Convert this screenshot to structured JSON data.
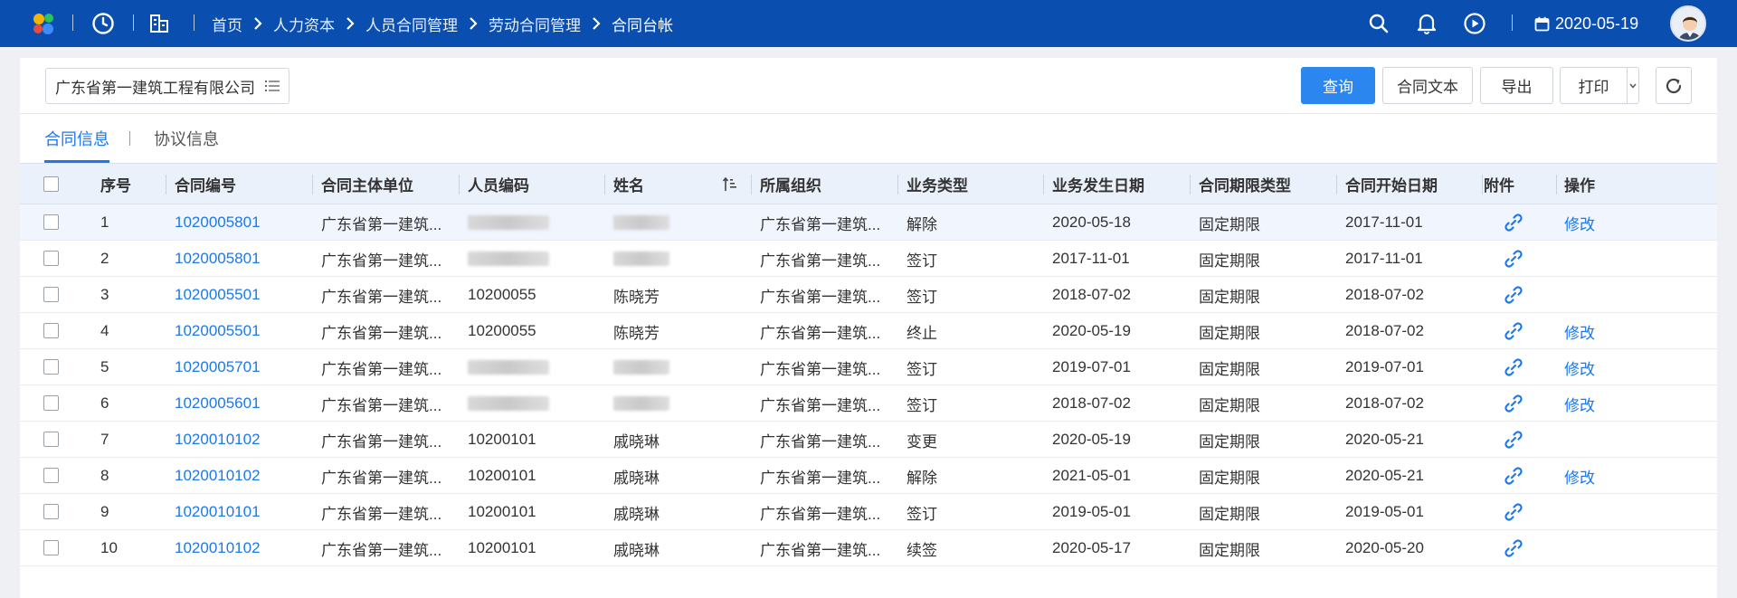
{
  "topbar": {
    "breadcrumbs": [
      "首页",
      "人力资本",
      "人员合同管理",
      "劳动合同管理",
      "合同台帐"
    ],
    "date": "2020-05-19",
    "icons": [
      "app-logo-icon",
      "clock-icon",
      "building-icon",
      "search-icon",
      "bell-icon",
      "play-circle-icon",
      "calendar-icon",
      "avatar"
    ]
  },
  "toolbar": {
    "company": "广东省第一建筑工程有限公司",
    "query_label": "查询",
    "contract_text_label": "合同文本",
    "export_label": "导出",
    "print_label": "打印"
  },
  "tabs": [
    {
      "label": "合同信息",
      "active": true
    },
    {
      "label": "协议信息",
      "active": false
    }
  ],
  "table": {
    "headers": [
      "序号",
      "合同编号",
      "合同主体单位",
      "人员编码",
      "姓名",
      "所属组织",
      "业务类型",
      "业务发生日期",
      "合同期限类型",
      "合同开始日期",
      "附件",
      "操作"
    ],
    "rows": [
      {
        "no": "1",
        "contract_no": "1020005801",
        "entity": "广东省第一建筑...",
        "code": "",
        "name": "",
        "org": "广东省第一建筑...",
        "type": "解除",
        "date": "2020-05-18",
        "term": "固定期限",
        "start": "2017-11-01",
        "action": "修改"
      },
      {
        "no": "2",
        "contract_no": "1020005801",
        "entity": "广东省第一建筑...",
        "code": "",
        "name": "",
        "org": "广东省第一建筑...",
        "type": "签订",
        "date": "2017-11-01",
        "term": "固定期限",
        "start": "2017-11-01",
        "action": ""
      },
      {
        "no": "3",
        "contract_no": "1020005501",
        "entity": "广东省第一建筑...",
        "code": "10200055",
        "name": "陈晓芳",
        "org": "广东省第一建筑...",
        "type": "签订",
        "date": "2018-07-02",
        "term": "固定期限",
        "start": "2018-07-02",
        "action": ""
      },
      {
        "no": "4",
        "contract_no": "1020005501",
        "entity": "广东省第一建筑...",
        "code": "10200055",
        "name": "陈晓芳",
        "org": "广东省第一建筑...",
        "type": "终止",
        "date": "2020-05-19",
        "term": "固定期限",
        "start": "2018-07-02",
        "action": "修改"
      },
      {
        "no": "5",
        "contract_no": "1020005701",
        "entity": "广东省第一建筑...",
        "code": "",
        "name": "",
        "org": "广东省第一建筑...",
        "type": "签订",
        "date": "2019-07-01",
        "term": "固定期限",
        "start": "2019-07-01",
        "action": "修改"
      },
      {
        "no": "6",
        "contract_no": "1020005601",
        "entity": "广东省第一建筑...",
        "code": "",
        "name": "",
        "org": "广东省第一建筑...",
        "type": "签订",
        "date": "2018-07-02",
        "term": "固定期限",
        "start": "2018-07-02",
        "action": "修改"
      },
      {
        "no": "7",
        "contract_no": "1020010102",
        "entity": "广东省第一建筑...",
        "code": "10200101",
        "name": "戚晓琳",
        "org": "广东省第一建筑...",
        "type": "变更",
        "date": "2020-05-19",
        "term": "固定期限",
        "start": "2020-05-21",
        "action": ""
      },
      {
        "no": "8",
        "contract_no": "1020010102",
        "entity": "广东省第一建筑...",
        "code": "10200101",
        "name": "戚晓琳",
        "org": "广东省第一建筑...",
        "type": "解除",
        "date": "2021-05-01",
        "term": "固定期限",
        "start": "2020-05-21",
        "action": "修改"
      },
      {
        "no": "9",
        "contract_no": "1020010101",
        "entity": "广东省第一建筑...",
        "code": "10200101",
        "name": "戚晓琳",
        "org": "广东省第一建筑...",
        "type": "签订",
        "date": "2019-05-01",
        "term": "固定期限",
        "start": "2019-05-01",
        "action": ""
      },
      {
        "no": "10",
        "contract_no": "1020010102",
        "entity": "广东省第一建筑...",
        "code": "10200101",
        "name": "戚晓琳",
        "org": "广东省第一建筑...",
        "type": "续签",
        "date": "2020-05-17",
        "term": "固定期限",
        "start": "2020-05-20",
        "action": ""
      }
    ]
  },
  "colors": {
    "topbar": "#0a4fb0",
    "primary": "#2b86f0",
    "link": "#1f78e8",
    "header_bg": "#eaf1fb"
  }
}
